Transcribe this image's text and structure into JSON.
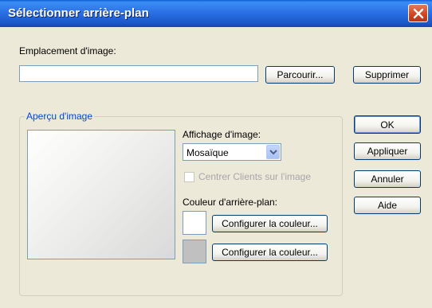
{
  "window": {
    "title": "Sélectionner arrière-plan",
    "close_icon": "close-icon"
  },
  "image_location": {
    "label": "Emplacement d'image:",
    "value": "",
    "browse_label": "Parcourir...",
    "delete_label": "Supprimer"
  },
  "preview_group": {
    "legend": "Aperçu d'image"
  },
  "display": {
    "label": "Affichage d'image:",
    "selected": "Mosaïque"
  },
  "center_option": {
    "label": "Centrer Clients sur l'image",
    "checked": false,
    "enabled": false
  },
  "background_color": {
    "label": "Couleur d'arrière-plan:",
    "swatch1_color": "#ffffff",
    "swatch2_color": "#c0c0c0",
    "configure1_label": "Configurer la couleur...",
    "configure2_label": "Configurer la couleur..."
  },
  "side_buttons": {
    "ok": "OK",
    "apply": "Appliquer",
    "cancel": "Annuler",
    "help": "Aide"
  }
}
